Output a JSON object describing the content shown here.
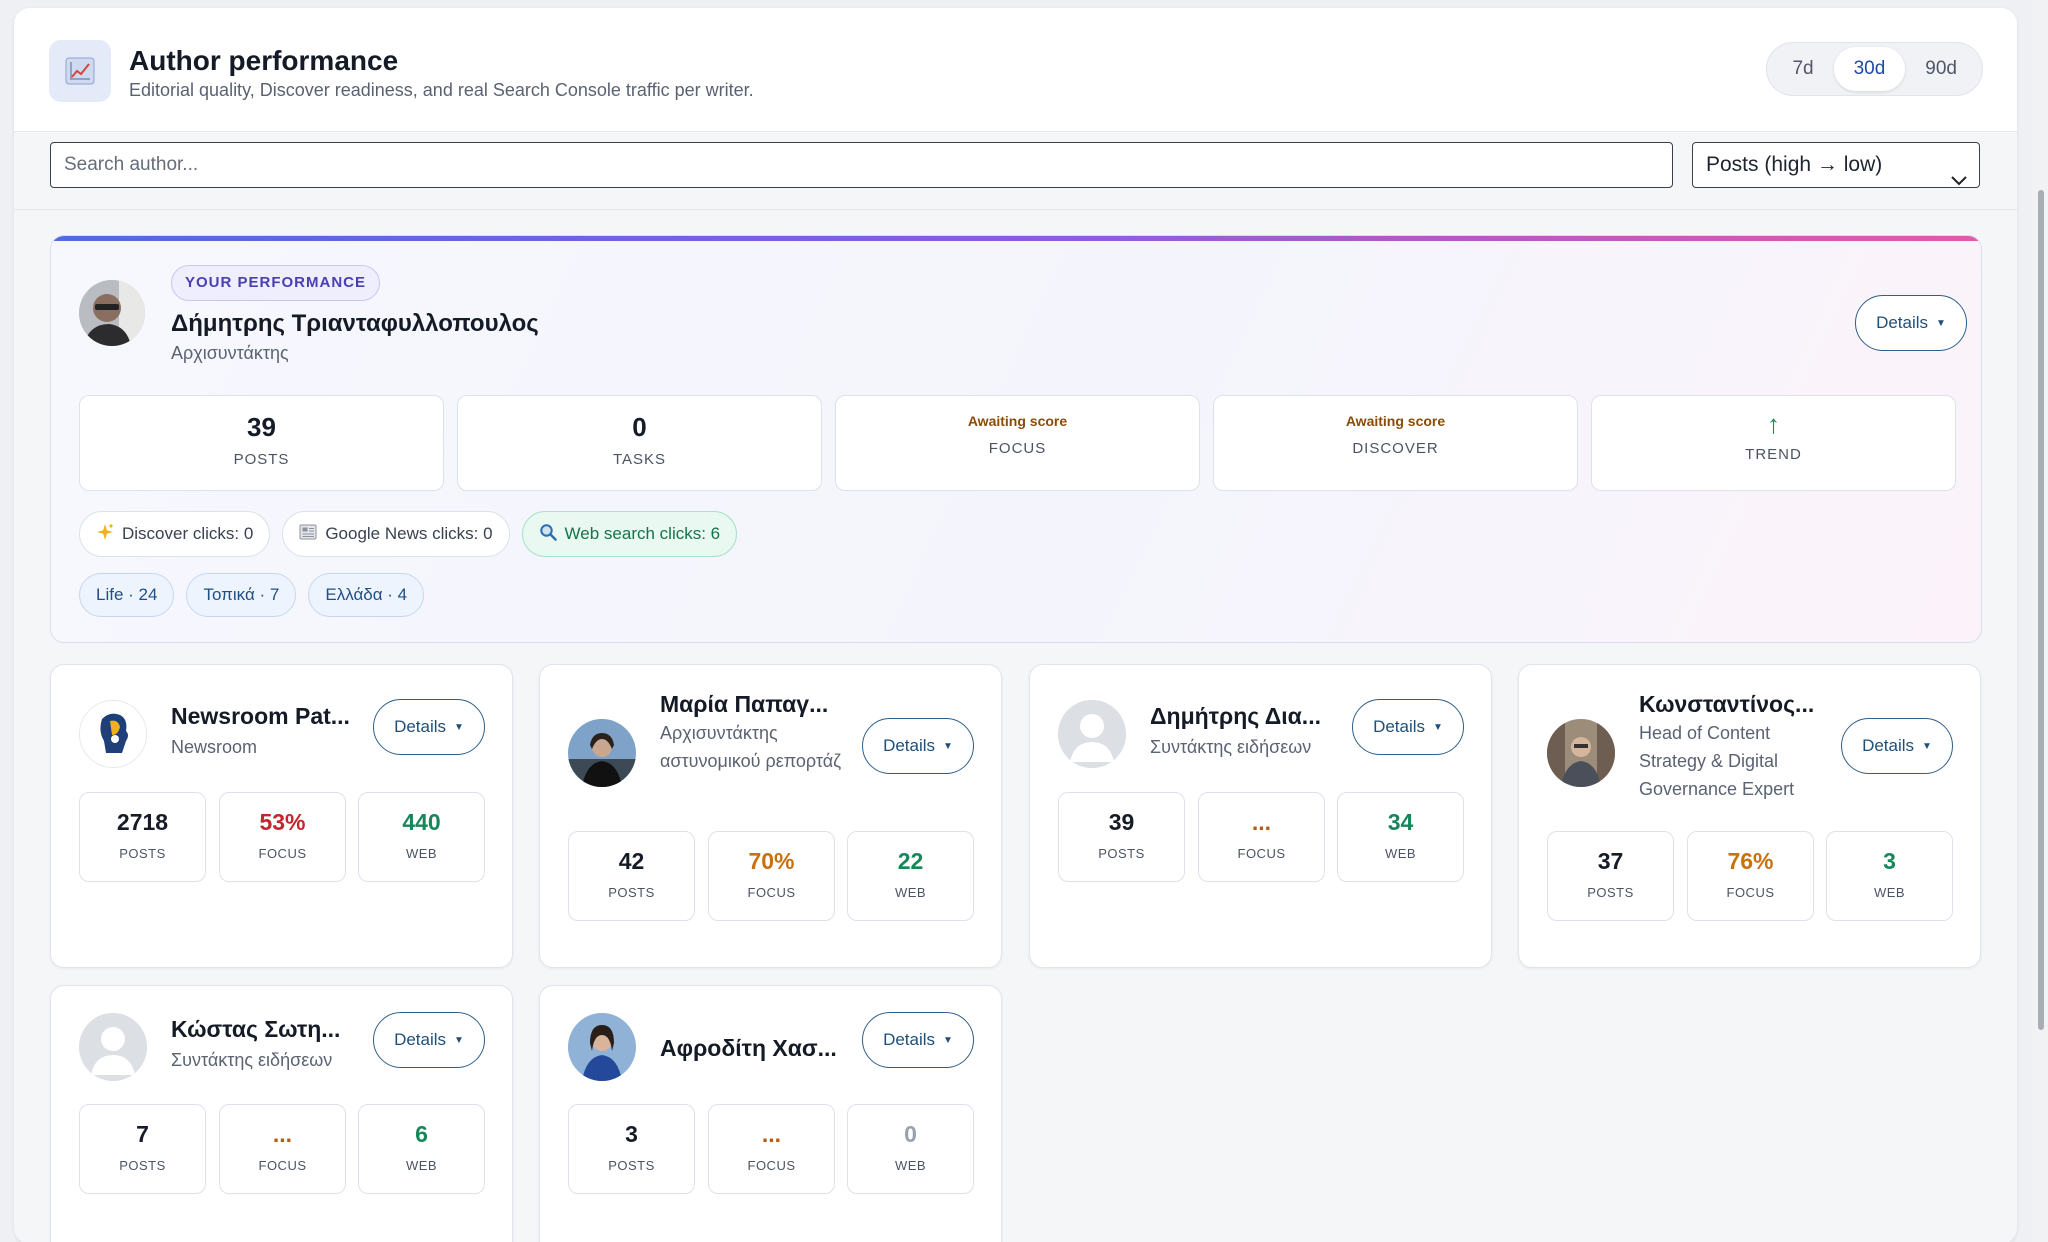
{
  "header": {
    "title": "Author performance",
    "subtitle": "Editorial quality, Discover readiness, and real Search Console traffic per writer.",
    "icon": "chart-icon",
    "ranges": [
      "7d",
      "30d",
      "90d"
    ],
    "active_range": "30d"
  },
  "toolbar": {
    "search_placeholder": "Search author...",
    "sort_value": "Posts (high → low)"
  },
  "hero": {
    "badge": "YOUR PERFORMANCE",
    "name": "Δήμητρης Τριανταφυλλοπουλος",
    "role": "Αρχισυντάκτης",
    "details_label": "Details",
    "stats": {
      "posts": {
        "value": "39",
        "label": "POSTS"
      },
      "tasks": {
        "value": "0",
        "label": "TASKS"
      },
      "focus": {
        "status": "Awaiting score",
        "label": "FOCUS"
      },
      "discover": {
        "status": "Awaiting score",
        "label": "DISCOVER"
      },
      "trend": {
        "icon": "up-arrow-icon",
        "label": "TREND"
      }
    },
    "clicks": {
      "discover": "Discover clicks: 0",
      "google_news": "Google News clicks: 0",
      "web_search": "Web search clicks: 6"
    },
    "categories": [
      "Life · 24",
      "Τοπικά · 7",
      "Ελλάδα · 4"
    ]
  },
  "authors": [
    {
      "name": "Newsroom Pat...",
      "role": "Newsroom",
      "details_label": "Details",
      "posts": "2718",
      "focus": "53%",
      "web": "440",
      "posts_label": "POSTS",
      "focus_label": "FOCUS",
      "web_label": "WEB"
    },
    {
      "name": "Μαρία Παπαγ...",
      "role": "Αρχισυντάκτης αστυνομικού ρεπορτάζ",
      "details_label": "Details",
      "posts": "42",
      "focus": "70%",
      "web": "22",
      "posts_label": "POSTS",
      "focus_label": "FOCUS",
      "web_label": "WEB"
    },
    {
      "name": "Δημήτρης Δια...",
      "role": "Συντάκτης ειδήσεων",
      "details_label": "Details",
      "posts": "39",
      "focus": "...",
      "web": "34",
      "posts_label": "POSTS",
      "focus_label": "FOCUS",
      "web_label": "WEB"
    },
    {
      "name": "Κωνσταντίνος...",
      "role": "Head of Content Strategy & Digital Governance Expert",
      "details_label": "Details",
      "posts": "37",
      "focus": "76%",
      "web": "3",
      "posts_label": "POSTS",
      "focus_label": "FOCUS",
      "web_label": "WEB"
    },
    {
      "name": "Κώστας Σωτη...",
      "role": "Συντάκτης ειδήσεων",
      "details_label": "Details",
      "posts": "7",
      "focus": "...",
      "web": "6",
      "posts_label": "POSTS",
      "focus_label": "FOCUS",
      "web_label": "WEB"
    },
    {
      "name": "Αφροδίτη Χασ...",
      "role": "",
      "details_label": "Details",
      "posts": "3",
      "focus": "...",
      "web": "0",
      "posts_label": "POSTS",
      "focus_label": "FOCUS",
      "web_label": "WEB"
    }
  ],
  "colors": {
    "accent": "#1b4aa8",
    "focus_low": "#c4262e",
    "focus_mid": "#c8710f",
    "web_green": "#17875a",
    "awaiting": "#8a4c08"
  }
}
